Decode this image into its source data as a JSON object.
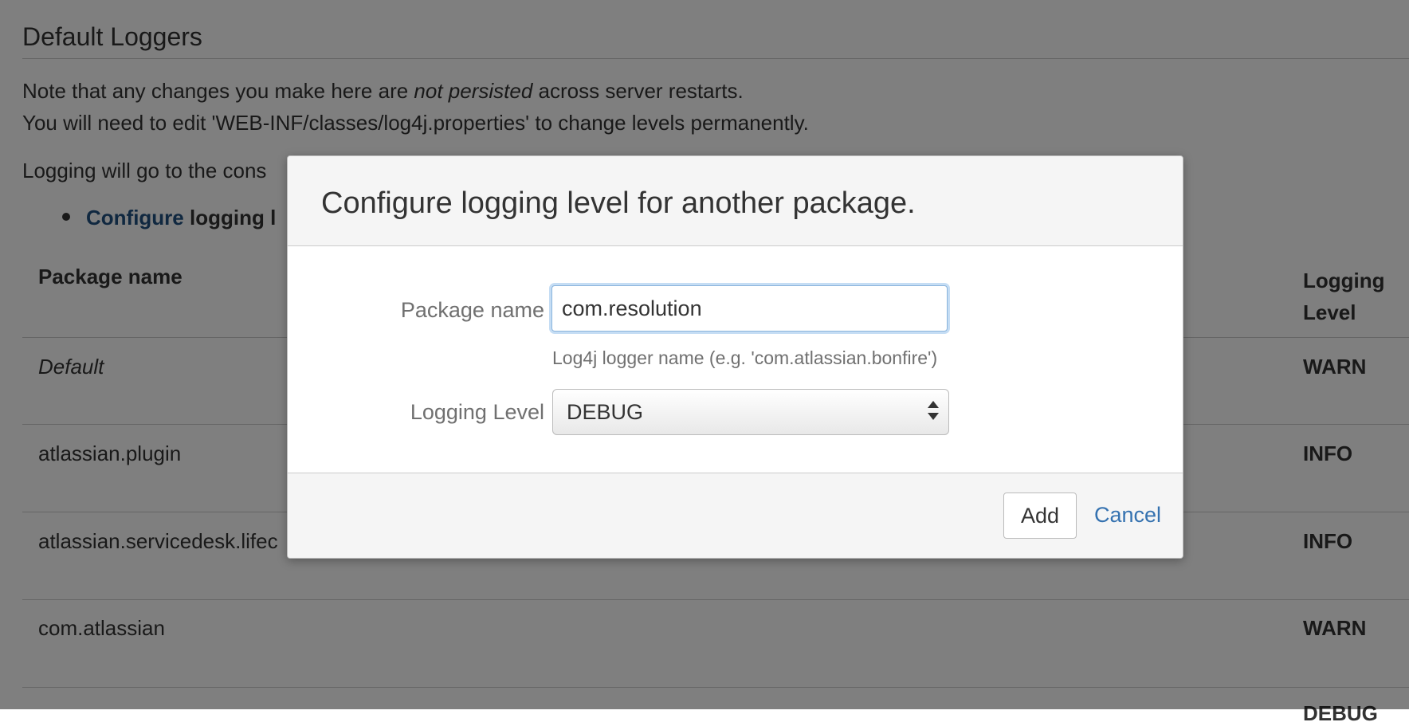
{
  "page": {
    "section_title": "Default Loggers",
    "note_line1_pre": "Note that any changes you make here are ",
    "note_line1_em": "not persisted",
    "note_line1_post": " across server restarts.",
    "note_line2": "You will need to edit 'WEB-INF/classes/log4j.properties' to change levels permanently.",
    "note_line3": "Logging will go to the cons",
    "bullet_link": "Configure",
    "bullet_text": "logging l"
  },
  "table": {
    "headers": {
      "package": "Package name",
      "level_line1": "Logging",
      "level_line2": "Level"
    },
    "rows": [
      {
        "package": "Default",
        "level": "WARN"
      },
      {
        "package": "atlassian.plugin",
        "level": "INFO"
      },
      {
        "package": "atlassian.servicedesk.lifec",
        "level": "INFO"
      },
      {
        "package": "com.atlassian",
        "level": "WARN"
      },
      {
        "package": "",
        "level": "DEBUG"
      }
    ]
  },
  "dialog": {
    "title": "Configure logging level for another package.",
    "package_label": "Package name",
    "package_value": "com.resolution",
    "package_help": "Log4j logger name (e.g. 'com.atlassian.bonfire')",
    "level_label": "Logging Level",
    "level_value": "DEBUG",
    "add_label": "Add",
    "cancel_label": "Cancel"
  },
  "colors": {
    "link": "#205081",
    "cancel_link": "#3572b0",
    "input_focus": "#8ab4dc",
    "overlay": "rgba(0,0,0,0.5)"
  },
  "icons": {
    "select_arrows": "up-down-caret-icon",
    "bullet": "bullet-dot-icon"
  }
}
